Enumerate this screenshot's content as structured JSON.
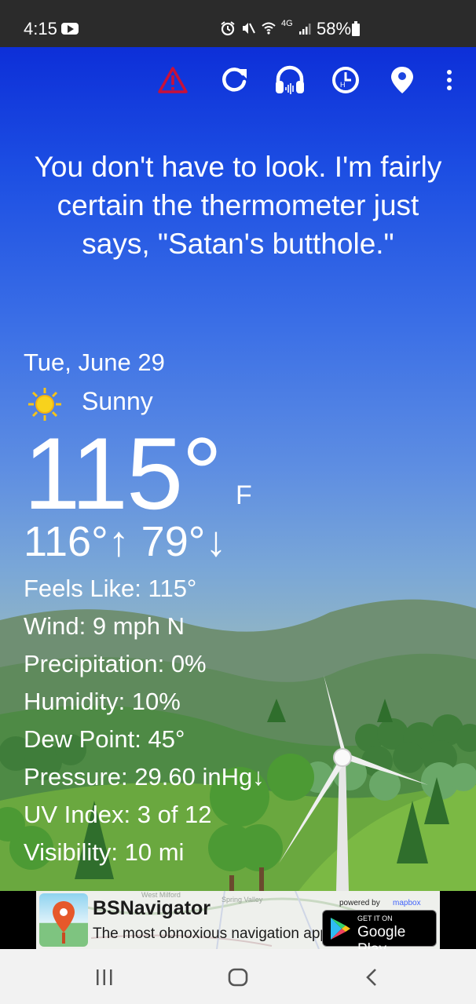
{
  "status_bar": {
    "time": "4:15",
    "network": "4G",
    "battery": "58%"
  },
  "toolbar": {
    "icons": [
      "alert-icon",
      "refresh-icon",
      "headphones-icon",
      "history-icon",
      "location-icon",
      "more-icon"
    ],
    "alert_color": "#d0122a"
  },
  "quote": {
    "text": "You don't have to look. I'm fairly certain the thermometer just says, \"Satan's butthole.\""
  },
  "weather": {
    "date": "Tue, June 29",
    "condition": "Sunny",
    "condition_icon": "sun-icon",
    "temperature": "115°",
    "unit": "F",
    "high_low": "116°↑ 79°↓",
    "details": [
      "Feels Like: 115°",
      "Wind: 9 mph N",
      "Precipitation: 0%",
      "Humidity: 10%",
      "Dew Point: 45°",
      "Pressure: 29.60 inHg↓",
      "UV Index: 3 of 12",
      "Visibility: 10 mi"
    ]
  },
  "ad": {
    "title": "BSNavigator",
    "subtitle": "The most obnoxious navigation app.",
    "powered_by": "powered by",
    "mapbox": "mapbox",
    "map_label_1": "West Milford",
    "map_label_2": "Spring Valley",
    "play_small": "GET IT ON",
    "play_big": "Google Play"
  },
  "nav_bar": {
    "icons": [
      "recent-apps-icon",
      "home-icon",
      "back-icon"
    ]
  }
}
